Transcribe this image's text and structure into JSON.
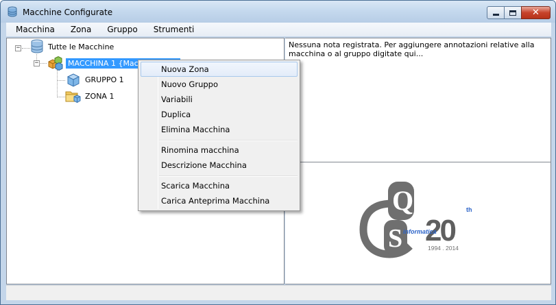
{
  "window": {
    "title": "Macchine Configurate",
    "title_icon": "database-icon"
  },
  "menubar": {
    "items": [
      "Macchina",
      "Zona",
      "Gruppo",
      "Strumenti"
    ]
  },
  "tree": {
    "root": {
      "label": "Tutte le Macchine",
      "icon": "database-icon",
      "expander": "−"
    },
    "machine": {
      "label": "MACCHINA 1 {Macch",
      "icon": "cube-stack-icon",
      "expander": "−"
    },
    "children": [
      {
        "label": "GRUPPO 1",
        "icon": "cube-icon"
      },
      {
        "label": "ZONA 1",
        "icon": "folder-cube-icon"
      }
    ]
  },
  "notes": {
    "text": "Nessuna nota registrata. Per aggiungere annotazioni relative alla macchina o al gruppo digitate qui..."
  },
  "context_menu": {
    "items": [
      "Nuova Zona",
      "Nuovo Gruppo",
      "Variabili",
      "Duplica",
      "Elimina Macchina",
      "Rinomina macchina",
      "Descrizione Macchina",
      "Scarica Macchina",
      "Carica Anteprima Macchina"
    ],
    "hovered_index": 0
  },
  "logo": {
    "letter_q": "Q",
    "letter_s": "S",
    "number": "20",
    "superscript": "th",
    "tagline": "informatica",
    "years": "1994 . 2014"
  },
  "colors": {
    "selection": "#3399ff",
    "logo_gray": "#6f6f6f",
    "logo_blue": "#2b63c8"
  }
}
